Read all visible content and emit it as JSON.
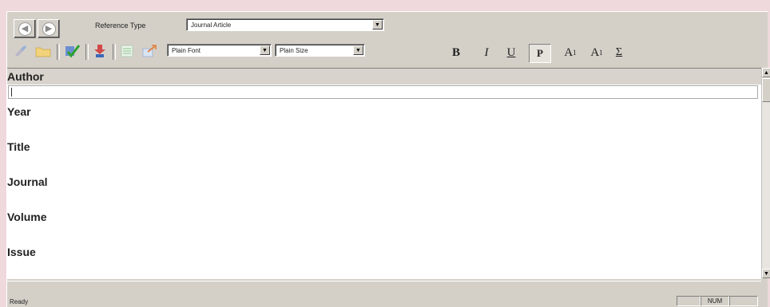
{
  "toolbar": {
    "back_icon": "back-arrow-icon",
    "forward_icon": "forward-arrow-icon",
    "reference_type_label": "Reference Type",
    "reference_type_value": "Journal Article",
    "font_value": "Plain Font",
    "size_value": "Plain Size",
    "bold_label": "B",
    "italic_label": "I",
    "underline_label": "U",
    "plain_label": "P",
    "superscript_base": "A",
    "superscript_mark": "1",
    "subscript_base": "A",
    "subscript_mark": "1",
    "symbol_label": "Σ"
  },
  "fields": {
    "author": "Author",
    "year": "Year",
    "title": "Title",
    "journal": "Journal",
    "volume": "Volume",
    "issue": "Issue"
  },
  "status": {
    "text": "Ready",
    "num": "NUM"
  },
  "colors": {
    "background": "#efd9dc",
    "chrome": "#d4d0c8",
    "author_band": "#d8d4cd"
  }
}
